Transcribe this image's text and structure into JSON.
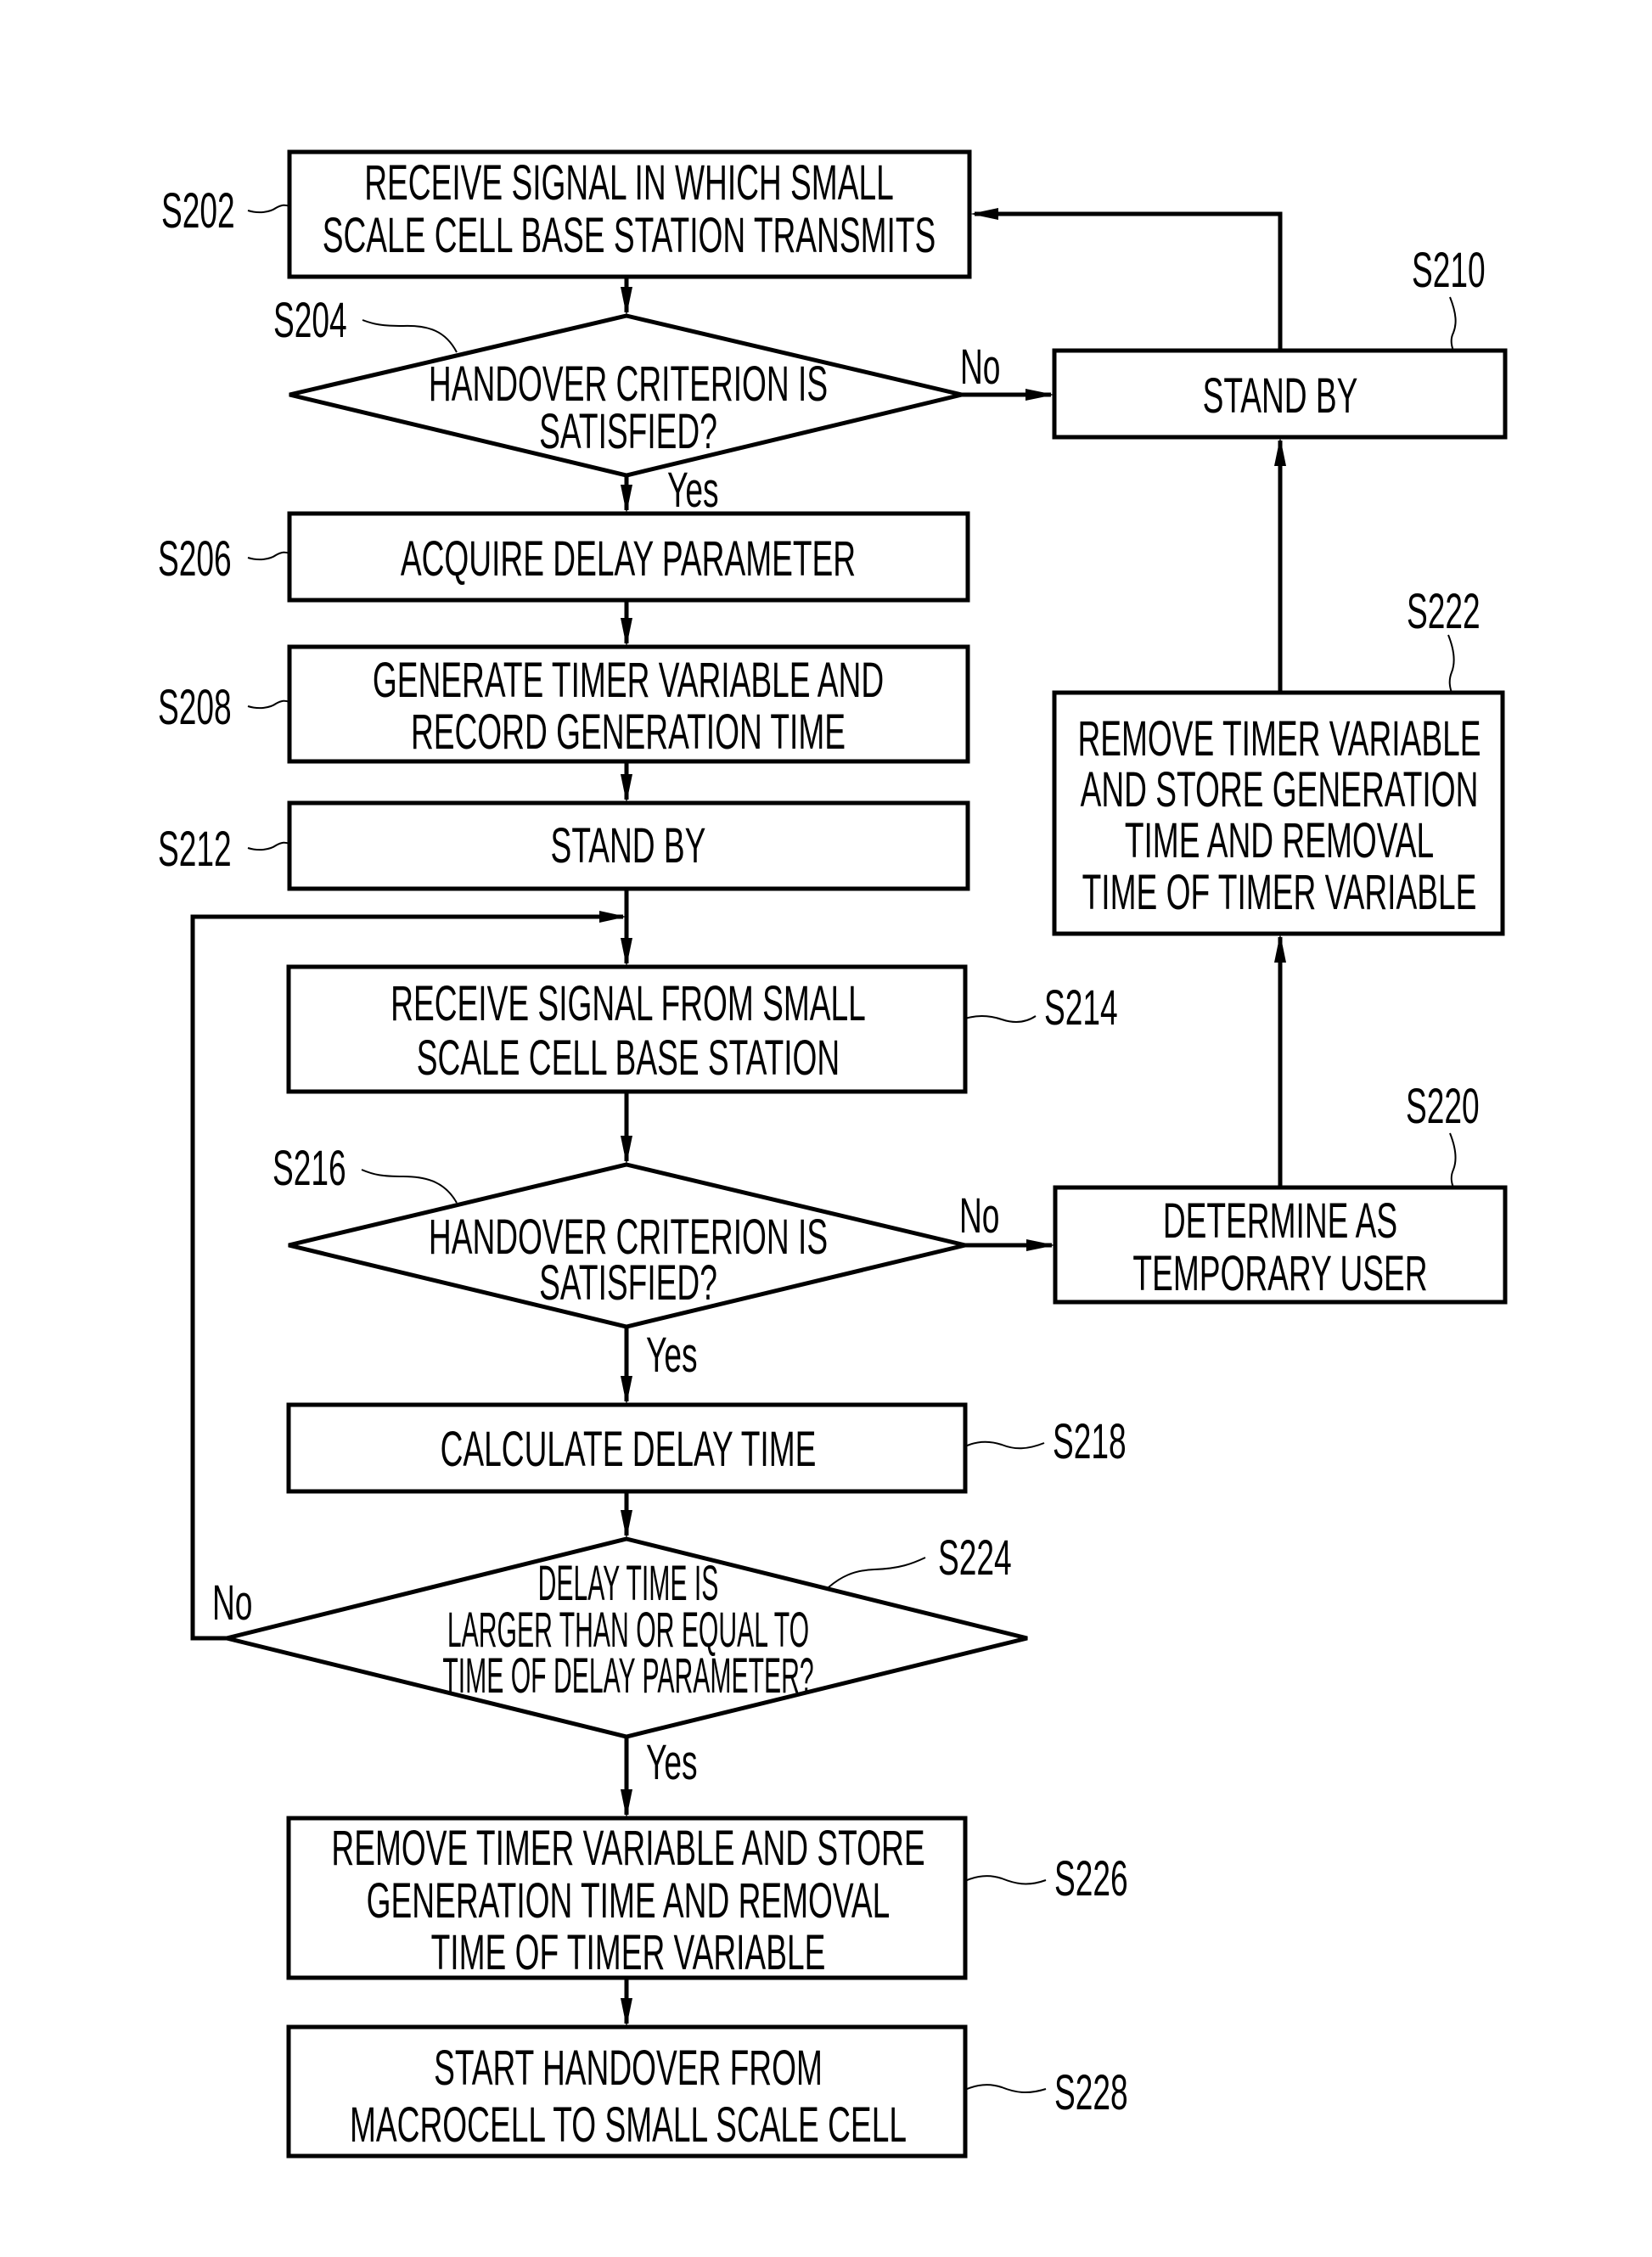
{
  "diagram": {
    "type": "flowchart",
    "steps": {
      "s202": {
        "id": "S202",
        "lines": [
          "RECEIVE SIGNAL IN WHICH SMALL",
          "SCALE CELL BASE STATION TRANSMITS"
        ]
      },
      "s204": {
        "id": "S204",
        "lines": [
          "HANDOVER CRITERION IS",
          "SATISFIED?"
        ]
      },
      "s206": {
        "id": "S206",
        "lines": [
          "ACQUIRE DELAY PARAMETER"
        ]
      },
      "s208": {
        "id": "S208",
        "lines": [
          "GENERATE TIMER VARIABLE AND",
          "RECORD GENERATION TIME"
        ]
      },
      "s210": {
        "id": "S210",
        "lines": [
          "STAND BY"
        ]
      },
      "s212": {
        "id": "S212",
        "lines": [
          "STAND BY"
        ]
      },
      "s214": {
        "id": "S214",
        "lines": [
          "RECEIVE SIGNAL FROM SMALL",
          "SCALE CELL BASE STATION"
        ]
      },
      "s216": {
        "id": "S216",
        "lines": [
          "HANDOVER CRITERION IS",
          "SATISFIED?"
        ]
      },
      "s218": {
        "id": "S218",
        "lines": [
          "CALCULATE DELAY TIME"
        ]
      },
      "s220": {
        "id": "S220",
        "lines": [
          "DETERMINE AS",
          "TEMPORARY USER"
        ]
      },
      "s222": {
        "id": "S222",
        "lines": [
          "REMOVE TIMER VARIABLE",
          "AND STORE GENERATION",
          "TIME AND REMOVAL",
          "TIME OF TIMER VARIABLE"
        ]
      },
      "s224": {
        "id": "S224",
        "lines": [
          "DELAY TIME IS",
          "LARGER THAN OR EQUAL TO",
          "TIME OF DELAY PARAMETER?"
        ]
      },
      "s226": {
        "id": "S226",
        "lines": [
          "REMOVE TIMER VARIABLE AND STORE",
          "GENERATION TIME AND REMOVAL",
          "TIME OF TIMER VARIABLE"
        ]
      },
      "s228": {
        "id": "S228",
        "lines": [
          "START HANDOVER FROM",
          "MACROCELL TO SMALL SCALE CELL"
        ]
      }
    },
    "branch_labels": {
      "s204_yes": "Yes",
      "s204_no": "No",
      "s216_yes": "Yes",
      "s216_no": "No",
      "s224_yes": "Yes",
      "s224_no": "No"
    },
    "edges": [
      {
        "from": "S202",
        "to": "S204"
      },
      {
        "from": "S204",
        "to": "S206",
        "label": "Yes"
      },
      {
        "from": "S204",
        "to": "S210",
        "label": "No"
      },
      {
        "from": "S210",
        "to": "S202"
      },
      {
        "from": "S206",
        "to": "S208"
      },
      {
        "from": "S208",
        "to": "S212"
      },
      {
        "from": "S212",
        "to": "S214"
      },
      {
        "from": "S214",
        "to": "S216"
      },
      {
        "from": "S216",
        "to": "S218",
        "label": "Yes"
      },
      {
        "from": "S216",
        "to": "S220",
        "label": "No"
      },
      {
        "from": "S220",
        "to": "S222"
      },
      {
        "from": "S222",
        "to": "S210"
      },
      {
        "from": "S218",
        "to": "S224"
      },
      {
        "from": "S224",
        "to": "S226",
        "label": "Yes"
      },
      {
        "from": "S224",
        "to": "S214",
        "label": "No"
      },
      {
        "from": "S226",
        "to": "S228"
      }
    ]
  }
}
